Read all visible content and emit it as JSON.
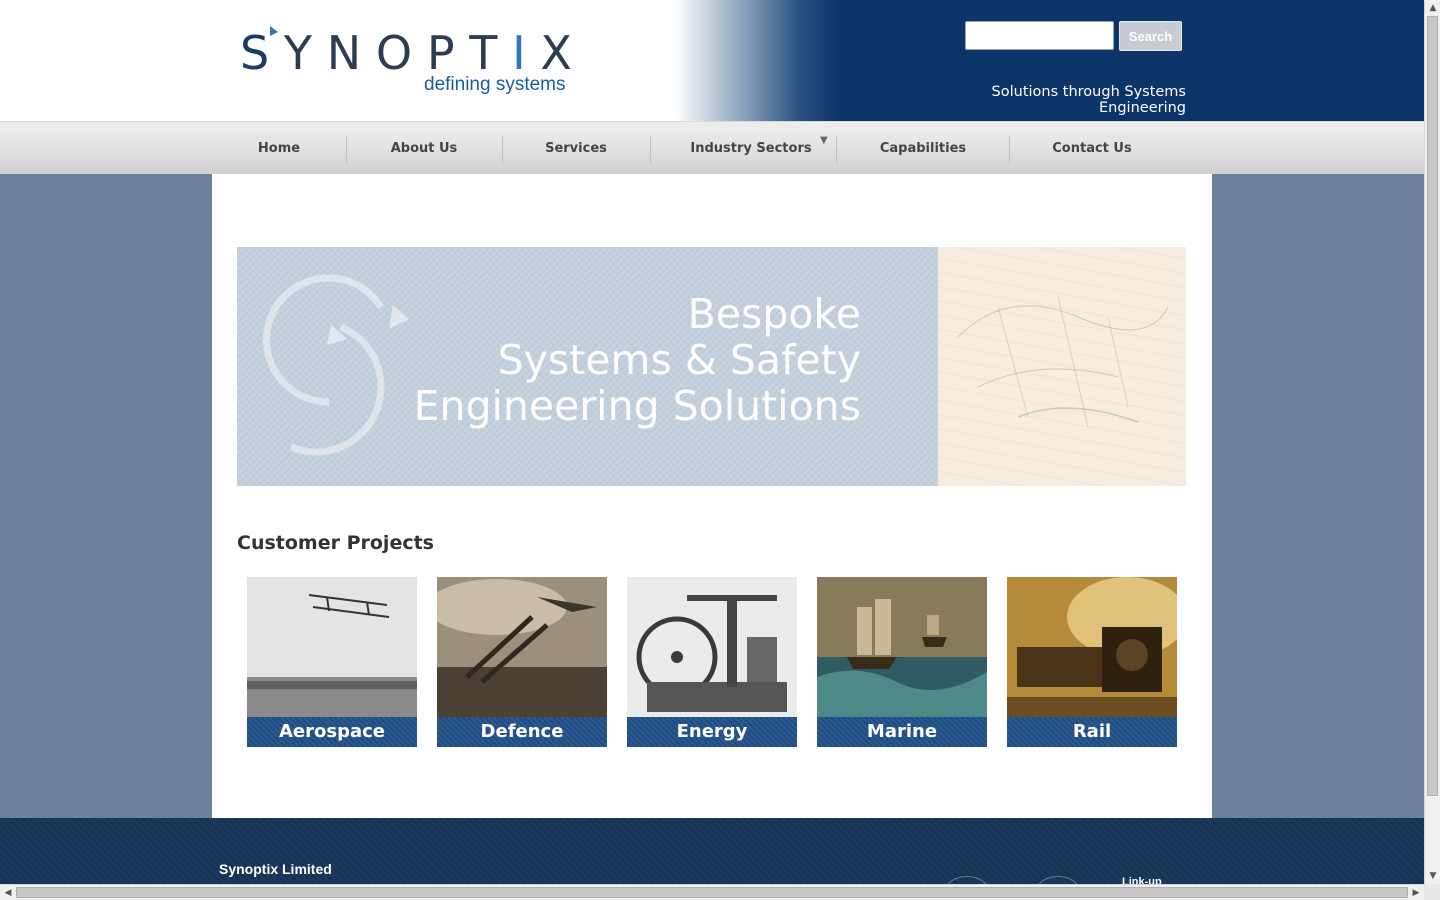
{
  "header": {
    "logo_letters": [
      "S",
      "Y",
      "N",
      "O",
      "P",
      "T",
      "I",
      "X"
    ],
    "logo_tagline": "defining systems",
    "search": {
      "placeholder": "",
      "value": "",
      "button_label": "Search"
    },
    "tagline": "Solutions through Systems Engineering"
  },
  "nav": {
    "items": [
      {
        "label": "Home"
      },
      {
        "label": "About Us"
      },
      {
        "label": "Services"
      },
      {
        "label": "Industry Sectors",
        "has_dropdown": true,
        "dropdown_icon": "chevron-down-icon"
      },
      {
        "label": "Capabilities"
      },
      {
        "label": "Contact Us"
      }
    ]
  },
  "banner": {
    "lines": [
      "Bespoke",
      "Systems & Safety",
      "Engineering Solutions"
    ]
  },
  "projects": {
    "title": "Customer Projects",
    "tiles": [
      {
        "label": "Aerospace",
        "image": "biplane-photo"
      },
      {
        "label": "Defence",
        "image": "anti-aircraft-gun-photo"
      },
      {
        "label": "Energy",
        "image": "steam-engine-photo"
      },
      {
        "label": "Marine",
        "image": "sailing-ships-painting"
      },
      {
        "label": "Rail",
        "image": "steam-locomotive-photo"
      }
    ]
  },
  "footer": {
    "company": "Synoptix Limited",
    "linkup": "Link-up"
  },
  "colors": {
    "header_blue": "#0b3468",
    "page_background": "#6e819c",
    "tile_label_blue": "#1e4c84",
    "footer_navy": "#163456",
    "logo_blue": "#1d5aa1"
  }
}
